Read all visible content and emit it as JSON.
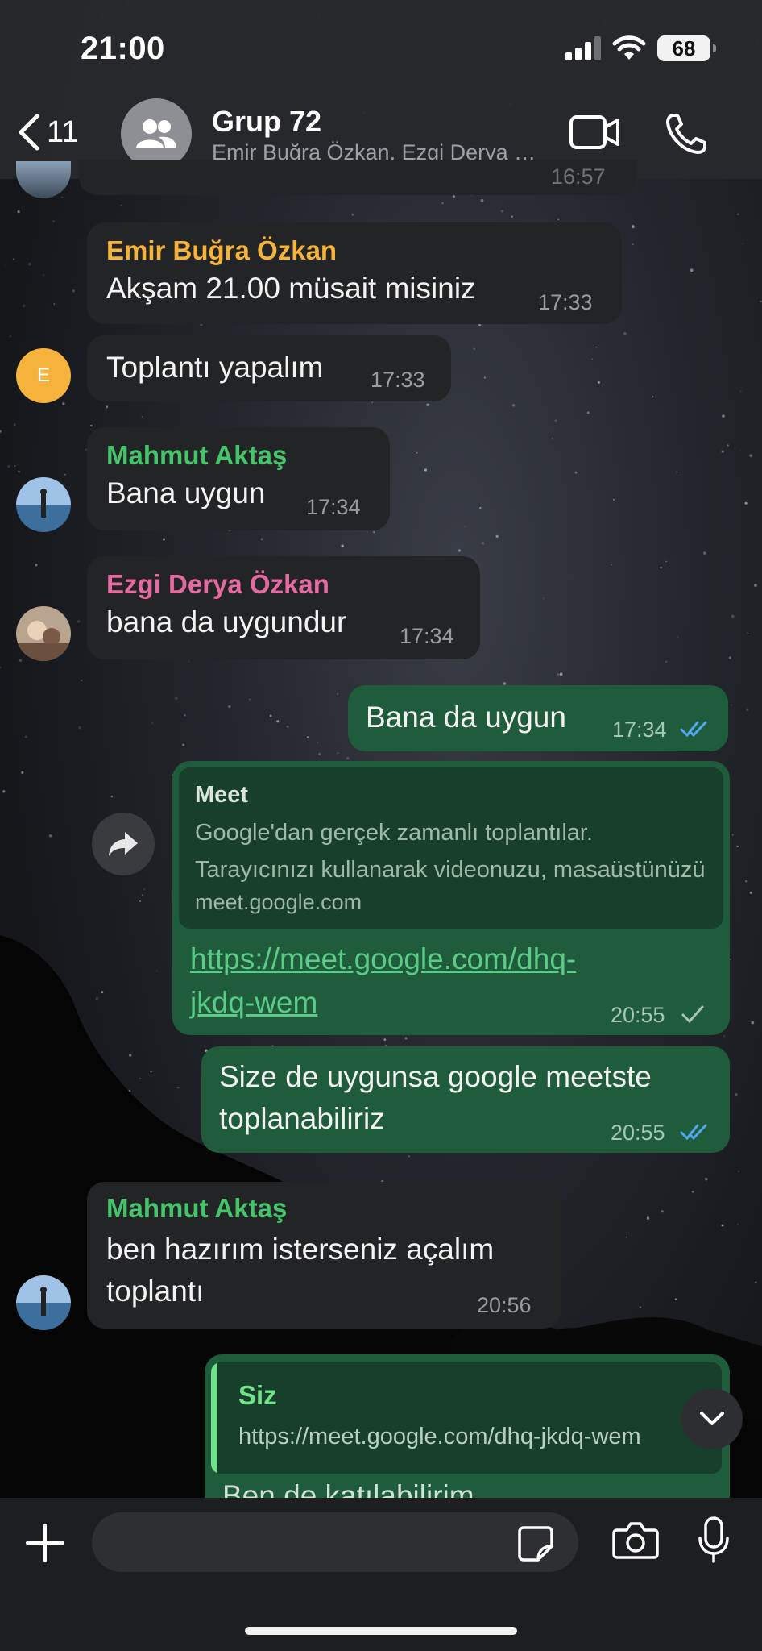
{
  "status_bar": {
    "time": "21:00",
    "battery": "68"
  },
  "header": {
    "back_count": "11",
    "title": "Grup 72",
    "subtitle": "Emir Buğra Özkan, Ezgi Derya Özkan, Mahmut Aktaş, Siz"
  },
  "partial_top_time": "16:57",
  "messages": [
    {
      "sender": "Emir Buğra Özkan",
      "sender_color": "#f5b33c",
      "text": "Akşam 21.00 müsait misiniz",
      "time": "17:33"
    },
    {
      "avatar_letter": "E",
      "text": "Toplantı yapalım",
      "time": "17:33"
    },
    {
      "sender": "Mahmut Aktaş",
      "sender_color": "#45c46b",
      "text": "Bana uygun",
      "time": "17:34"
    },
    {
      "sender": "Ezgi Derya Özkan",
      "sender_color": "#e46aa0",
      "text": "bana da uygundur",
      "time": "17:34"
    },
    {
      "text": "Bana da uygun",
      "time": "17:34",
      "status": "read"
    },
    {
      "preview_title": "Meet",
      "preview_desc_1": "Google'dan gerçek zamanlı toplantılar.",
      "preview_desc_2": "Tarayıcınızı kullanarak videonuzu, masaüstünüzü",
      "preview_domain": "meet.google.com",
      "link_line_1": "https://meet.google.com/dhq-",
      "link_line_2": "jkdq-wem",
      "time": "20:55",
      "status": "sent"
    },
    {
      "text_line_1": "Size de uygunsa google meetste",
      "text_line_2": "toplanabiliriz",
      "time": "20:55",
      "status": "read"
    },
    {
      "sender": "Mahmut Aktaş",
      "sender_color": "#45c46b",
      "text_line_1": "ben hazırım isterseniz açalım",
      "text_line_2": "toplantı",
      "time": "20:56"
    },
    {
      "quote_name": "Siz",
      "quote_text": "https://meet.google.com/dhq-jkdq-wem",
      "partial_text": "Ben de katılabilirim"
    }
  ],
  "colors": {
    "outgoing_bubble": "#1f5c3c",
    "incoming_bubble": "#232426",
    "read_tick": "#53a6f0"
  }
}
